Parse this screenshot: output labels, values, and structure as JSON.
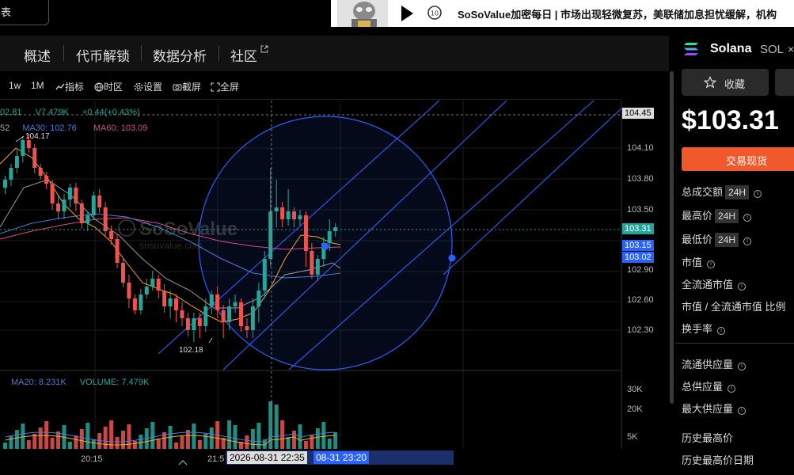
{
  "topbar": {
    "left_box_text": "表",
    "promo_text": "SoSoValue加密每日 | 市场出现轻微复苏，美联储加息担忧缓解，机构"
  },
  "nav": {
    "tabs": [
      "概述",
      "代币解锁",
      "数据分析",
      "社区"
    ]
  },
  "toolbar": {
    "intervals": [
      "1w",
      "1M"
    ],
    "indicator": "指标",
    "timezone": "时区",
    "settings": "设置",
    "screenshot": "截屏",
    "fullscreen": "全屏"
  },
  "chart_info": {
    "ohlc_tail": "02.81",
    "volume_label": "V7.479K",
    "change": "+0.44(+0.43%)",
    "ma_left": "52",
    "ma30": "MA30: 102.76",
    "ma60": "MA60: 103.09",
    "high_mark": "104.17",
    "low_mark": "102.18",
    "vol_ma20": "MA20: 8.231K",
    "vol_volume": "VOLUME: 7.479K"
  },
  "price_axis": {
    "crosshair_price": "104.45",
    "ticks": [
      "104.10",
      "103.80",
      "103.50",
      "102.90",
      "102.60",
      "102.30"
    ],
    "last_price": "103.31",
    "ma_tag1": "103.15",
    "ma_tag2": "103.02"
  },
  "volume_axis": {
    "ticks": [
      "30K",
      "20K",
      "5K"
    ]
  },
  "time_axis": {
    "labels": [
      "20:15",
      "21:5"
    ],
    "crosshair_time": "2026-08-31 22:35",
    "range_end_time": "08-31 23:20"
  },
  "colors": {
    "up": "#26a69a",
    "down": "#ef5350",
    "accent": "#2962ff",
    "ma_orange": "#f5a623",
    "ma_blue": "#4a7bd8",
    "ma_pink": "#d64b8c",
    "trade": "#f0592b"
  },
  "right_panel": {
    "coin_name": "Solana",
    "coin_symbol": "SOL",
    "close_glyph": "×",
    "favorite_label": "收藏",
    "price": "$103.31",
    "trade_label": "交易现货",
    "stats": [
      {
        "label": "总成交额",
        "badge": "24H"
      },
      {
        "label": "最高价",
        "badge": "24H"
      },
      {
        "label": "最低价",
        "badge": "24H"
      },
      {
        "label": "市值",
        "badge": ""
      },
      {
        "label": "全流通市值",
        "badge": ""
      },
      {
        "label": "市值 / 全流通市值 比例",
        "badge": ""
      },
      {
        "label": "换手率",
        "badge": ""
      }
    ],
    "supply": [
      {
        "label": "流通供应量"
      },
      {
        "label": "总供应量"
      },
      {
        "label": "最大供应量"
      }
    ],
    "history": [
      {
        "label": "历史最高价"
      },
      {
        "label": "历史最高价日期"
      }
    ]
  },
  "watermark": {
    "brand": "SoSoValue",
    "url": "sosovalue.com"
  }
}
